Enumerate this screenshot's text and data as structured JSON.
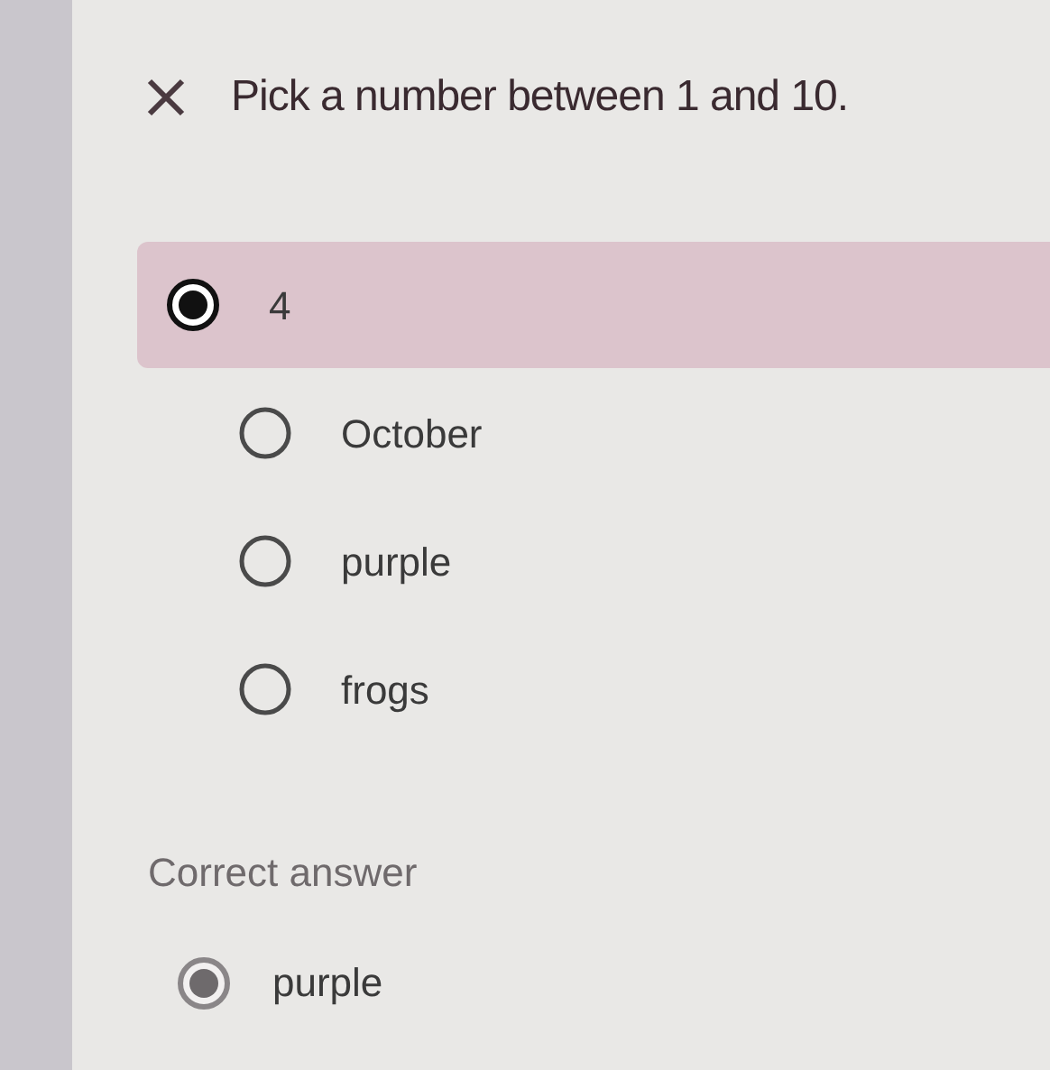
{
  "question": {
    "correct": false,
    "text": "Pick a number between 1 and 10."
  },
  "options": [
    {
      "label": "4",
      "selected": true
    },
    {
      "label": "October",
      "selected": false
    },
    {
      "label": "purple",
      "selected": false
    },
    {
      "label": "frogs",
      "selected": false
    }
  ],
  "correct_answer": {
    "heading": "Correct answer",
    "options": [
      {
        "label": "purple",
        "selected": true
      }
    ]
  }
}
